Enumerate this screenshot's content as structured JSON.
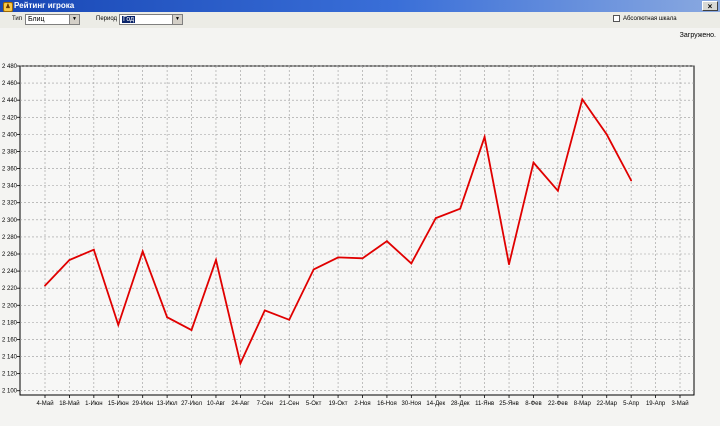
{
  "window": {
    "title": "Рейтинг игрока",
    "close_glyph": "×"
  },
  "toolbar": {
    "type_label": "Тип",
    "type_value": "Блиц",
    "period_label": "Период",
    "period_value": "Год",
    "absolute_scale_label": "Абсолютная шкала",
    "absolute_scale_checked": false
  },
  "status_text": "Загружено.",
  "chart_data": {
    "type": "line",
    "title": "",
    "xlabel": "",
    "ylabel": "",
    "ylim": [
      2095,
      2480
    ],
    "y_ticks": [
      "2 100",
      "2 120",
      "2 140",
      "2 160",
      "2 180",
      "2 200",
      "2 220",
      "2 240",
      "2 260",
      "2 280",
      "2 300",
      "2 320",
      "2 340",
      "2 360",
      "2 380",
      "2 400",
      "2 420",
      "2 440",
      "2 460",
      "2 480"
    ],
    "y_tick_values": [
      2100,
      2120,
      2140,
      2160,
      2180,
      2200,
      2220,
      2240,
      2260,
      2280,
      2300,
      2320,
      2340,
      2360,
      2380,
      2400,
      2420,
      2440,
      2460,
      2480
    ],
    "categories": [
      "4-Май",
      "18-Май",
      "1-Июн",
      "15-Июн",
      "29-Июн",
      "13-Июл",
      "27-Июл",
      "10-Авг",
      "24-Авг",
      "7-Сен",
      "21-Сен",
      "5-Окт",
      "19-Окт",
      "2-Ноя",
      "16-Ноя",
      "30-Ноя",
      "14-Дек",
      "28-Дек",
      "11-Янв",
      "25-Янв",
      "8-Фев",
      "22-Фев",
      "8-Мар",
      "22-Мар",
      "5-Апр",
      "19-Апр",
      "3-Май"
    ],
    "grid": true,
    "line_color": "#e00000",
    "series": [
      {
        "values": [
          2223,
          2253,
          2265,
          2177,
          2263,
          2186,
          2171,
          2253,
          2132,
          2194,
          2183,
          2242,
          2256,
          2255,
          2275,
          2249,
          2302,
          2313,
          2397,
          2248,
          2367,
          2334,
          2441,
          2400,
          2346
        ]
      }
    ]
  }
}
